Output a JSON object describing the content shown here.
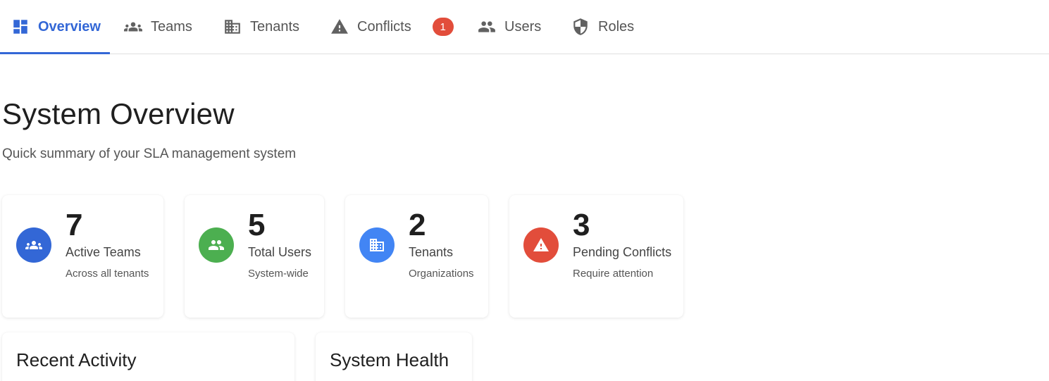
{
  "colors": {
    "accent": "#3367d6",
    "teams_icon": "#3367d6",
    "users_icon": "#4caf50",
    "tenants_icon": "#4285f4",
    "conflicts_icon": "#e24d3b",
    "badge": "#e24d3b"
  },
  "tabs": [
    {
      "label": "Overview",
      "icon": "dashboard-icon",
      "active": true
    },
    {
      "label": "Teams",
      "icon": "groups-icon",
      "active": false
    },
    {
      "label": "Tenants",
      "icon": "building-icon",
      "active": false
    },
    {
      "label": "Conflicts",
      "icon": "warning-icon",
      "active": false,
      "badge": "1"
    },
    {
      "label": "Users",
      "icon": "people-icon",
      "active": false
    },
    {
      "label": "Roles",
      "icon": "shield-icon",
      "active": false
    }
  ],
  "header": {
    "title": "System Overview",
    "subtitle": "Quick summary of your SLA management system"
  },
  "stats": [
    {
      "value": "7",
      "label": "Active Teams",
      "caption": "Across all tenants",
      "icon": "groups-icon"
    },
    {
      "value": "5",
      "label": "Total Users",
      "caption": "System-wide",
      "icon": "people-icon"
    },
    {
      "value": "2",
      "label": "Tenants",
      "caption": "Organizations",
      "icon": "building-icon"
    },
    {
      "value": "3",
      "label": "Pending Conflicts",
      "caption": "Require attention",
      "icon": "warning-icon"
    }
  ],
  "panels": {
    "recent_activity": {
      "title": "Recent Activity"
    },
    "system_health": {
      "title": "System Health"
    }
  }
}
